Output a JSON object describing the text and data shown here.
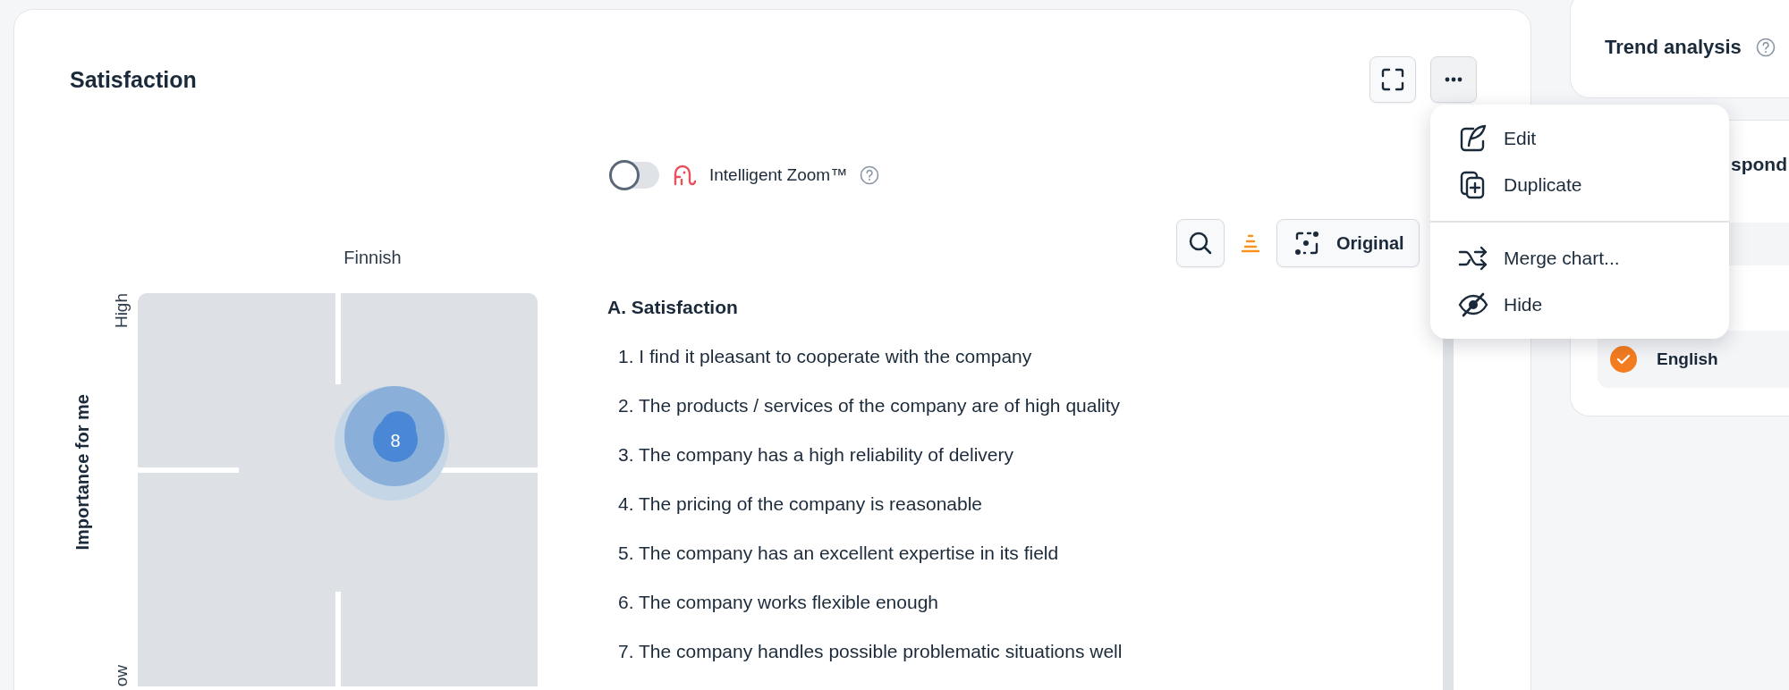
{
  "card": {
    "title": "Satisfaction"
  },
  "menu": {
    "groups": [
      [
        {
          "label": "Edit",
          "kind": "edit"
        },
        {
          "label": "Duplicate",
          "kind": "duplicate"
        }
      ],
      [
        {
          "label": "Merge chart...",
          "kind": "merge"
        },
        {
          "label": "Hide",
          "kind": "hide"
        }
      ]
    ]
  },
  "intelligent_zoom": {
    "label": "Intelligent Zoom™",
    "on": false
  },
  "view_button": {
    "label": "Original"
  },
  "chart": {
    "title": "Finnish",
    "y_axis": "Importance for me",
    "y_high": "High",
    "y_low": "ow",
    "bubble_label": "8"
  },
  "question_list": {
    "heading": "A. Satisfaction",
    "items": [
      "1. I find it pleasant to cooperate with the company",
      "2. The products / services of the company are of high quality",
      "3. The company has a high reliability of delivery",
      "4. The pricing of the company is reasonable",
      "5. The company has an excellent expertise in its field",
      "6. The company works flexible enough",
      "7. The company handles possible problematic situations well"
    ]
  },
  "side": {
    "trend_title": "Trend analysis",
    "second_title": "spond",
    "languages": [
      {
        "label": "English",
        "checked": true
      }
    ]
  }
}
